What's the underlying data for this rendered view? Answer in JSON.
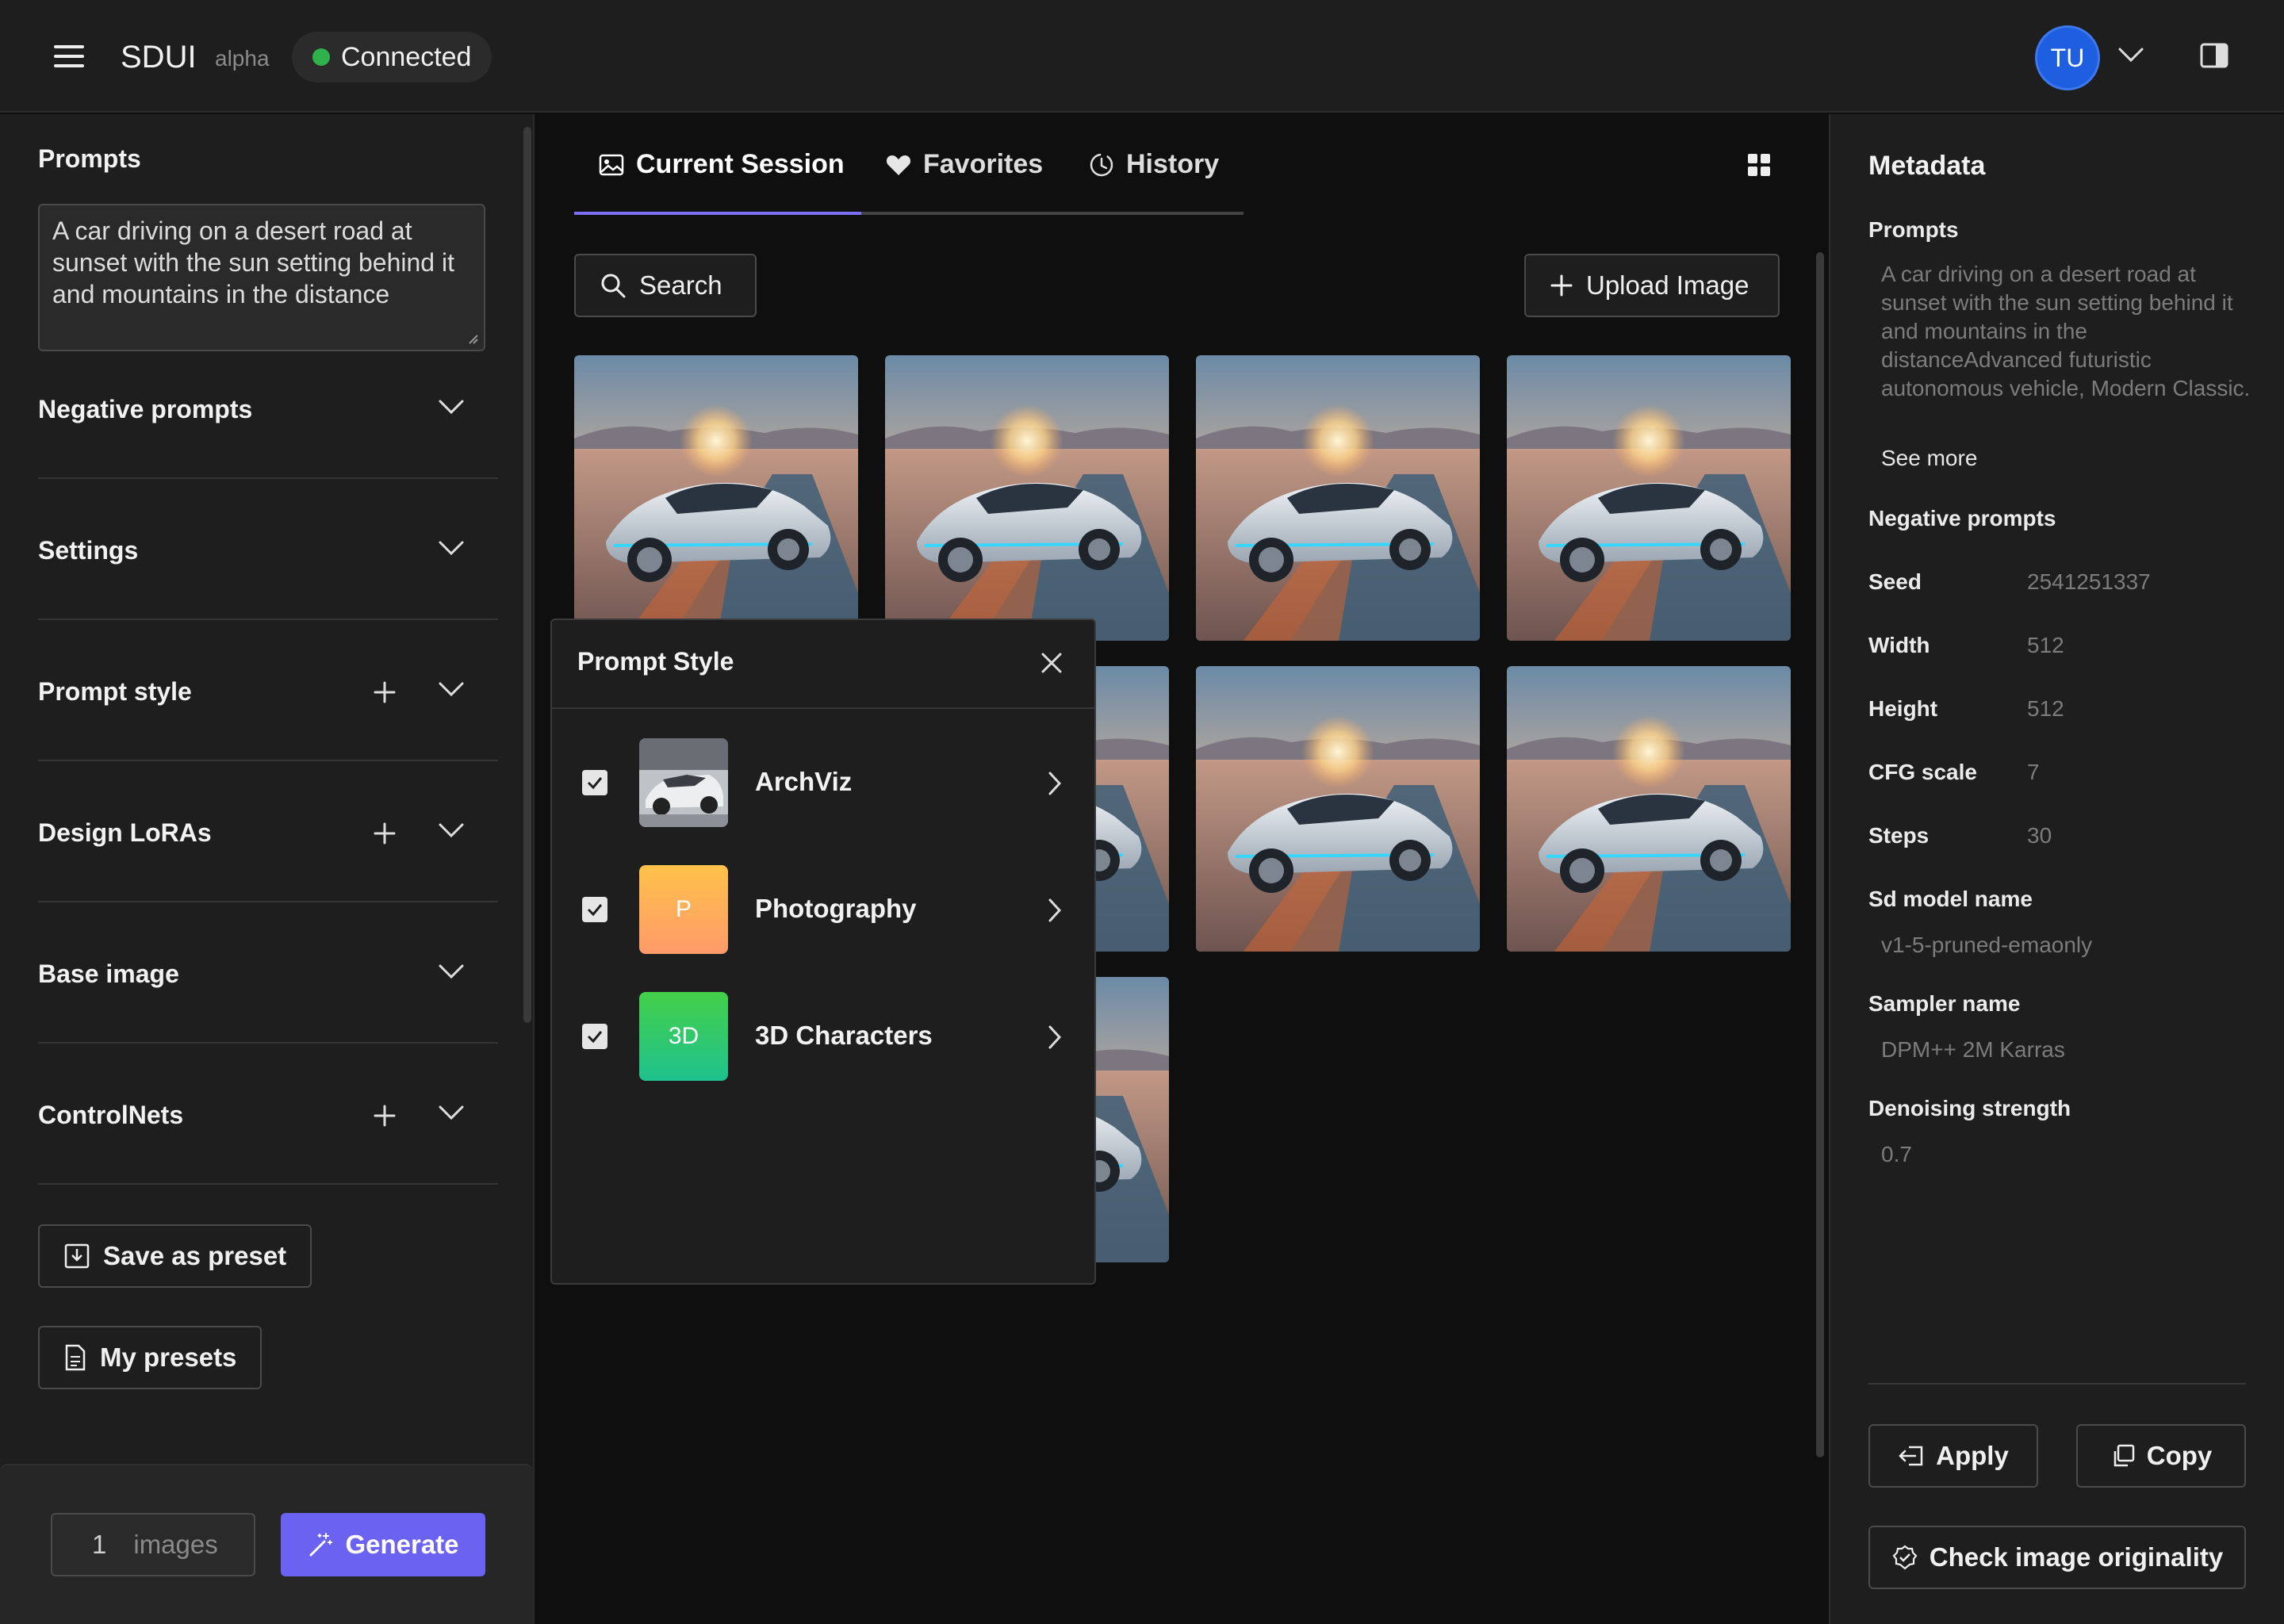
{
  "header": {
    "brand": "SDUI",
    "badge": "alpha",
    "status": "Connected",
    "avatar_initials": "TU"
  },
  "left": {
    "prompts_title": "Prompts",
    "prompt_text": "A car driving on a desert road at sunset with the sun setting behind it and mountains in the distance",
    "sections": [
      {
        "label": "Negative prompts",
        "has_add": false
      },
      {
        "label": "Settings",
        "has_add": false
      },
      {
        "label": "Prompt style",
        "has_add": true
      },
      {
        "label": "Design LoRAs",
        "has_add": true
      },
      {
        "label": "Base image",
        "has_add": false
      },
      {
        "label": "ControlNets",
        "has_add": true
      }
    ],
    "save_preset_label": "Save as preset",
    "my_presets_label": "My presets",
    "image_count": "1",
    "images_label": "images",
    "generate_label": "Generate"
  },
  "center": {
    "tabs": [
      {
        "label": "Current Session",
        "icon": "image-icon",
        "active": true
      },
      {
        "label": "Favorites",
        "icon": "heart-icon",
        "active": false
      },
      {
        "label": "History",
        "icon": "history-icon",
        "active": false
      }
    ],
    "search_label": "Search",
    "upload_label": "Upload Image",
    "thumbnail_count": 9
  },
  "popover": {
    "title": "Prompt Style",
    "items": [
      {
        "label": "ArchViz",
        "checked": true,
        "swatch_text": "",
        "swatch_kind": "photo"
      },
      {
        "label": "Photography",
        "checked": true,
        "swatch_text": "P",
        "swatch_kind": "orange"
      },
      {
        "label": "3D Characters",
        "checked": true,
        "swatch_text": "3D",
        "swatch_kind": "green"
      }
    ]
  },
  "metadata": {
    "title": "Metadata",
    "prompts_label": "Prompts",
    "prompts_value": "A car driving on a desert road at sunset with the sun setting behind it and mountains in the distanceAdvanced futuristic autonomous vehicle, Modern Classic.",
    "see_more": "See more",
    "negative_label": "Negative prompts",
    "fields": [
      {
        "key": "Seed",
        "value": "2541251337"
      },
      {
        "key": "Width",
        "value": "512"
      },
      {
        "key": "Height",
        "value": "512"
      },
      {
        "key": "CFG scale",
        "value": "7"
      },
      {
        "key": "Steps",
        "value": "30"
      }
    ],
    "sd_model_label": "Sd model name",
    "sd_model_value": "v1-5-pruned-emaonly",
    "sampler_label": "Sampler name",
    "sampler_value": "DPM++ 2M Karras",
    "denoise_label": "Denoising strength",
    "denoise_value": "0.7",
    "apply_label": "Apply",
    "copy_label": "Copy",
    "originality_label": "Check image originality"
  },
  "colors": {
    "accent": "#6c62f2",
    "connected": "#2fb24c",
    "avatar": "#1d5fe0"
  }
}
